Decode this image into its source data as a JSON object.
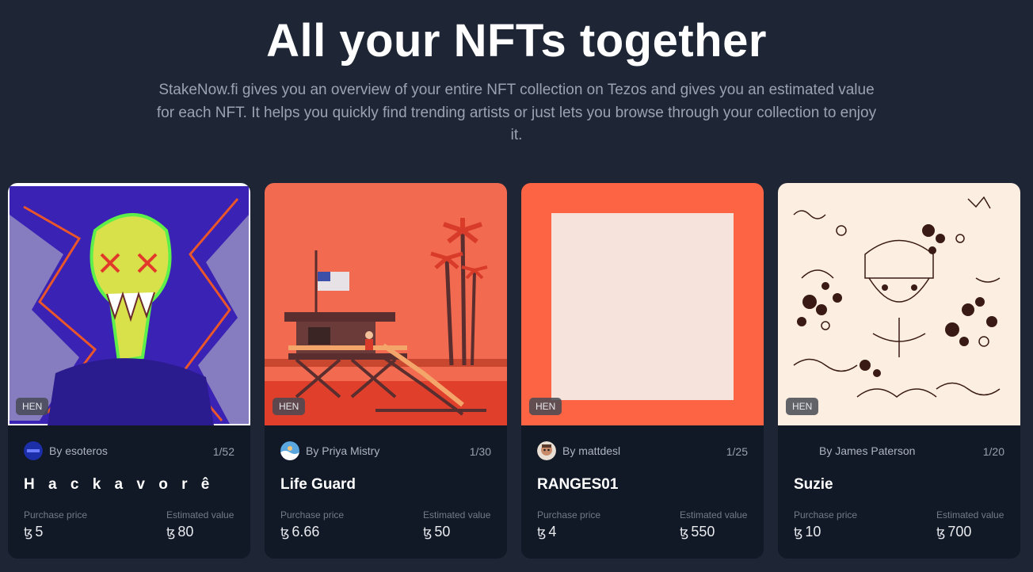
{
  "hero": {
    "title": "All your NFTs together",
    "subtitle": "StakeNow.fi gives you an overview of your entire NFT collection on Tezos and gives you an estimated value for each NFT. It helps you quickly find trending artists or just lets you browse through your collection to enjoy it."
  },
  "currency_symbol": "ꜩ",
  "cards": [
    {
      "badge": "HEN",
      "creator": "By esoteros",
      "edition": "1/52",
      "title": "H a c k a v o r ê",
      "purchase_label": "Purchase price",
      "purchase_value": "5",
      "estimated_label": "Estimated value",
      "estimated_value": "80",
      "art_colors": [
        "#3a1fb8",
        "#c9d84a",
        "#e8562a"
      ]
    },
    {
      "badge": "HEN",
      "creator": "By Priya Mistry",
      "edition": "1/30",
      "title": "Life Guard",
      "purchase_label": "Purchase price",
      "purchase_value": "6.66",
      "estimated_label": "Estimated value",
      "estimated_value": "50",
      "art_colors": [
        "#f26b50",
        "#e24b36",
        "#5a2e2e"
      ]
    },
    {
      "badge": "HEN",
      "creator": "By mattdesl",
      "edition": "1/25",
      "title": "RANGES01",
      "purchase_label": "Purchase price",
      "purchase_value": "4",
      "estimated_label": "Estimated value",
      "estimated_value": "550",
      "art_colors": [
        "#fc6444",
        "#f5e3dc"
      ]
    },
    {
      "badge": "HEN",
      "creator": "By James Paterson",
      "edition": "1/20",
      "title": "Suzie",
      "purchase_label": "Purchase price",
      "purchase_value": "10",
      "estimated_label": "Estimated value",
      "estimated_value": "700",
      "art_colors": [
        "#fdeee2",
        "#3a1a14"
      ]
    }
  ]
}
